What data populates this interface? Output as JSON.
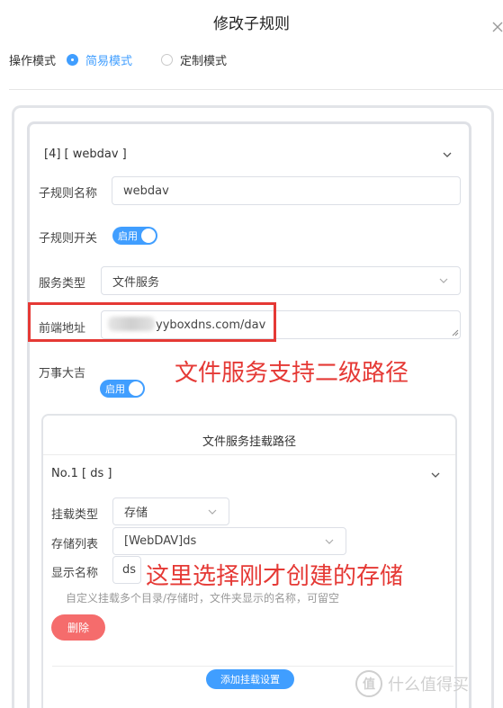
{
  "dialog": {
    "title": "修改子规则"
  },
  "mode": {
    "label": "操作模式",
    "options": [
      {
        "label": "简易模式",
        "selected": true
      },
      {
        "label": "定制模式",
        "selected": false
      }
    ]
  },
  "rule": {
    "header": "[4] [ webdav ]",
    "name_label": "子规则名称",
    "name_value": "webdav",
    "switch_label": "子规则开关",
    "switch_text": "启用",
    "service_label": "服务类型",
    "service_value": "文件服务",
    "frontend_label": "前端地址",
    "frontend_value": "yyboxdns.com/dav",
    "lucky_label": "万事大吉",
    "lucky_text": "启用"
  },
  "annotations": {
    "a1": "文件服务支持二级路径",
    "a2": "这里选择刚才创建的存储"
  },
  "mount": {
    "title": "文件服务挂载路径",
    "item_header": "No.1 [ ds ]",
    "type_label": "挂载类型",
    "type_value": "存储",
    "storage_label": "存储列表",
    "storage_value": "[WebDAV]ds",
    "display_label": "显示名称",
    "display_value": "ds",
    "hint": "自定义挂载多个目录/存储时，文件夹显示的名称，可留空",
    "delete_label": "删除",
    "add_label": "添加挂载设置"
  },
  "watermark": {
    "logo": "值",
    "text": "什么值得买"
  },
  "colors": {
    "accent": "#409eff",
    "danger": "#f56c6c",
    "annotation": "#e53935"
  }
}
